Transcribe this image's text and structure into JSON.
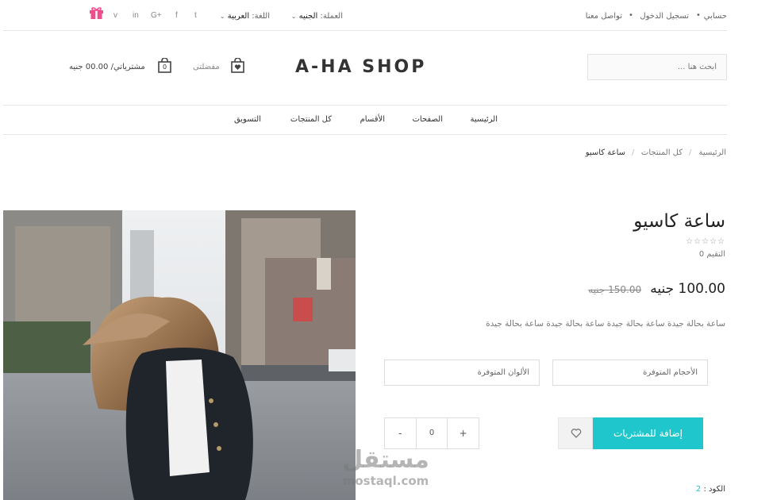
{
  "topbar": {
    "account": "حسابي",
    "login": "تسجيل الدخول",
    "contact": "تواصل معنا",
    "currency_label": "العملة:",
    "currency_value": "الجنيه",
    "language_label": "اللغة:",
    "language_value": "العربية",
    "social": [
      "v",
      "in",
      "G+",
      "f",
      "t"
    ],
    "gift_color": "#f14c8c"
  },
  "header": {
    "search_placeholder": "ابحث هنا ...",
    "logo": "A-HA SHOP",
    "wishlist_label": "مفضلتى",
    "cart_count": "0",
    "cart_label": "مشترياتي/ 00.00 جنيه"
  },
  "nav": {
    "items": [
      "الرئيسية",
      "الصفحات",
      "الأقسام",
      "كل المنتجات",
      "التسويق"
    ]
  },
  "breadcrumb": {
    "items": [
      "الرئيسية",
      "كل المنتجات",
      "ساعة كاسيو"
    ],
    "separator": "/"
  },
  "product": {
    "title": "ساعة كاسيو",
    "stars": "☆☆☆☆☆",
    "rating": "التقيم 0",
    "price": "100.00 جنيه",
    "old_price": "150.00 جنيه",
    "description": "ساعة بحالة جيدة ساعة بحالة جيدة ساعة بحالة جيدة ساعة بحالة جيدة",
    "sizes_label": "الأحجام المتوفرة",
    "colors_label": "الألوان المتوفرة",
    "qty_minus": "-",
    "qty_value": "0",
    "qty_plus": "+",
    "add_to_cart": "إضافة للمشتريات",
    "code_label": "الكود :",
    "code_value": "2",
    "accent_color": "#1fc7cc"
  },
  "watermark": {
    "arabic": "مستقل",
    "latin": "mostaql.com"
  }
}
